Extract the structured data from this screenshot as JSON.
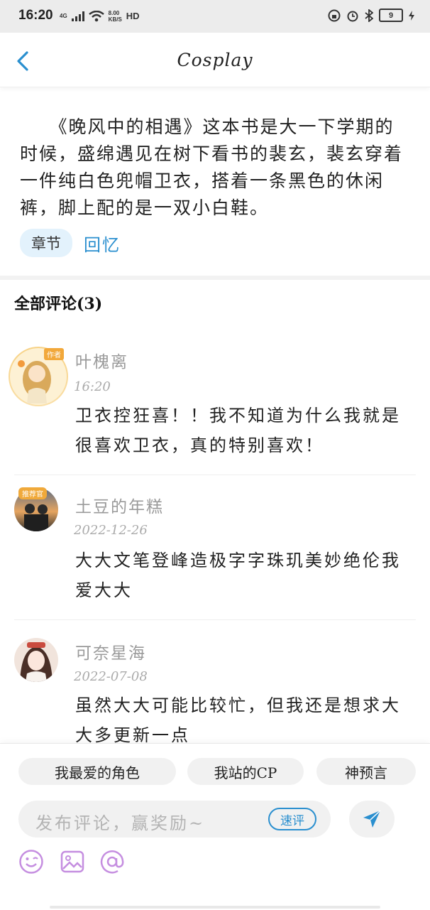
{
  "status_bar": {
    "time": "16:20",
    "network": "4G",
    "speed_value": "8.00",
    "speed_unit": "KB/S",
    "hd": "HD",
    "battery": "9"
  },
  "header": {
    "title": "Cosplay"
  },
  "intro": {
    "text": "　　《晚风中的相遇》这本书是大一下学期的时候，盛绵遇见在树下看书的裴玄，裴玄穿着一件纯白色兜帽卫衣，搭着一条黑色的休闲裤，脚上配的是一双小白鞋。",
    "tag_chip": "章节",
    "tag_link": "回忆"
  },
  "comments_section": {
    "title": "全部评论(3)",
    "items": [
      {
        "name": "叶槐离",
        "date": "16:20",
        "text": "卫衣控狂喜！！我不知道为什么我就是很喜欢卫衣，真的特别喜欢！",
        "avatar_badge": "作者"
      },
      {
        "name": "土豆的年糕",
        "date": "2022-12-26",
        "text": "大大文笔登峰造极字字珠玑美妙绝伦我爱大大",
        "avatar_badge": "推荐官"
      },
      {
        "name": "可奈星海",
        "date": "2022-07-08",
        "text": "虽然大大可能比较忙，但我还是想求大大多更新一点"
      }
    ]
  },
  "bottom_bar": {
    "quick_tags": [
      "我最爱的角色",
      "我站的CP",
      "神预言"
    ],
    "input_placeholder": "发布评论，赢奖励~",
    "quick_review": "速评"
  },
  "colors": {
    "accent": "#2a8fcf",
    "chip_bg": "#e3f2fc",
    "muted_text": "#9a9a9a",
    "tool_icon": "#c58ee0"
  },
  "icons": {
    "back": "chevron-left-icon",
    "send": "paper-plane-icon",
    "emoji": "smiley-icon",
    "image": "image-icon",
    "mention": "at-icon"
  }
}
